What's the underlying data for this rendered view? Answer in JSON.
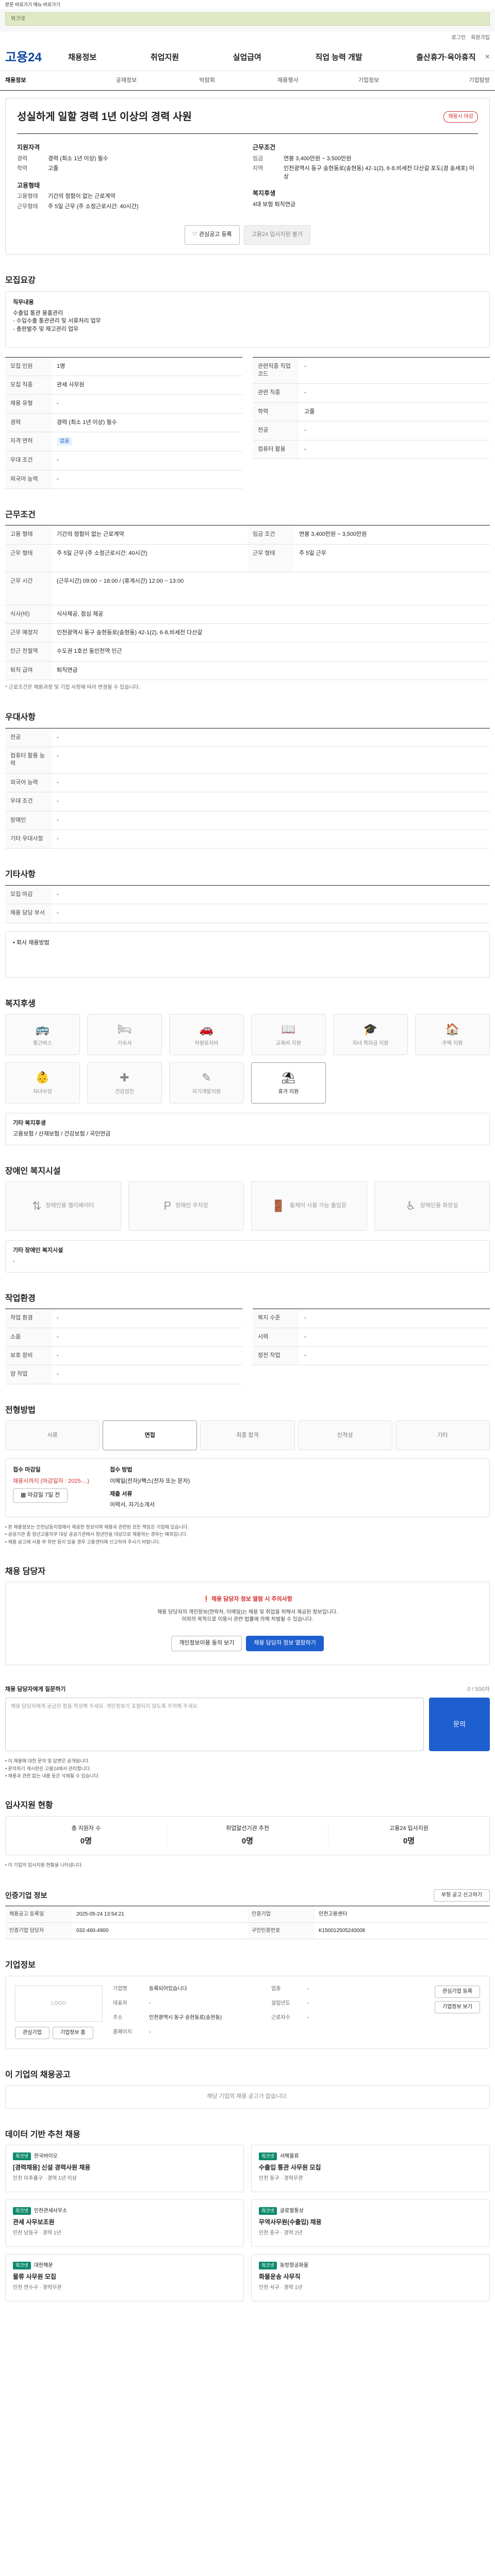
{
  "skip": {
    "text": "본문 바로가기 메뉴 바로가기"
  },
  "ad": {
    "text": "워크넷"
  },
  "util": {
    "login": "로그인",
    "join": "회원가입"
  },
  "header": {
    "logo": "고용24",
    "menu": [
      "채용정보",
      "취업지원",
      "실업급여",
      "직업 능력 개발",
      "출산휴가·육아휴직"
    ],
    "close": "×"
  },
  "tabs": [
    "채용정보",
    "공채정보",
    "박람회",
    "채용행사",
    "기업정보",
    "기업탐방"
  ],
  "job": {
    "title": "성실하게 일할 경력 1년 이상의 경력 사원",
    "badge": "채용시 마감",
    "left": {
      "sec1": "지원자격",
      "exp_k": "경력",
      "exp_v": "경력 (최소 1년 이상) 필수",
      "edu_k": "학력",
      "edu_v": "고졸",
      "sec2": "고용형태",
      "type_k": "고용형태",
      "type_v": "기간의 정함이 없는 근로계약",
      "time_k": "근무형태",
      "time_v": "주 5일 근무 (주 소정근로시간: 40시간)"
    },
    "right": {
      "sec1": "근무조건",
      "pay_k": "임금",
      "pay_v": "연봉 3,400만원 ~ 3,500만원",
      "loc_k": "지역",
      "loc_v": "인천광역시 동구 송현동로(송현동) 42-1(2), 6·8,비세전 다산갈 포도(경 송세포) 이상",
      "sec2": "복지후생",
      "welfare": "4대 보험 퇴직연금"
    },
    "btn_interest": "관심공고 등록",
    "btn_apply": "고용24 입사지원 불가"
  },
  "s_content": {
    "title": "모집요강",
    "body_title": "직무내용",
    "body": "수출입 통관 용품관리\n- 수입수출 통관관리 및 서류처리 업무\n- 총판발주 및 재고관리 업무"
  },
  "s_table1": [
    {
      "k": "모집 인원",
      "v": "1명"
    },
    {
      "k": "모집 직종",
      "v": "관세 사무원"
    },
    {
      "k": "채용 유형",
      "v": "-"
    },
    {
      "k": "경력",
      "v": "경력 (최소 1년 이상) 필수"
    },
    {
      "k": "자격 면허",
      "v": "없음"
    },
    {
      "k": "우대 조건",
      "v": "-"
    },
    {
      "k": "외국어 능력",
      "v": "-"
    }
  ],
  "s_table1b": [
    {
      "k": "관련직종 직업 코드",
      "v": "-"
    },
    {
      "k": "관련 직종",
      "v": "-"
    },
    {
      "k": "학력",
      "v": "고졸"
    },
    {
      "k": "전공",
      "v": "-"
    },
    {
      "k": "컴퓨터 활용",
      "v": "-"
    }
  ],
  "s_cond": {
    "title": "근무조건",
    "rows": [
      {
        "k": "고용 형태",
        "v": "기간의 정함이 없는 근로계약"
      },
      {
        "k": "근무 형태",
        "v": "주 5일 근무 (주 소정근로시간: 40시간)"
      },
      {
        "k": "근무 시간",
        "v": "(근무시간) 09:00 ~ 18:00 / (휴게시간) 12:00 ~ 13:00"
      },
      {
        "k": "식사(비)",
        "v": "식사제공, 점심 제공"
      },
      {
        "k": "근무 예정지",
        "v": "인천광역시 동구 송현동로(송현동) 42-1(2), 6·8,비세전 다산갈"
      },
      {
        "k": "인근 전철역",
        "v": "수도권 1호선 동인천역 인근"
      },
      {
        "k": "퇴직 급여",
        "v": "퇴직연금"
      }
    ],
    "pay": "연봉 3,400만원 ~ 3,500만원",
    "shift": "주 5일 근무",
    "note": "* 근로조건은 채용과정 및 기업 사정에 따라 변경될 수 있습니다."
  },
  "s_pref": {
    "title": "우대사항",
    "rows": [
      {
        "k": "전공",
        "v": "-"
      },
      {
        "k": "컴퓨터 활용 능력",
        "v": "-"
      },
      {
        "k": "외국어 능력",
        "v": "-"
      },
      {
        "k": "우대 조건",
        "v": "-"
      },
      {
        "k": "장애인",
        "v": "-"
      },
      {
        "k": "기타 우대사항",
        "v": "-"
      }
    ]
  },
  "s_etc": {
    "title": "기타사항",
    "rows": [
      {
        "k": "모집 마감",
        "v": "-"
      },
      {
        "k": "채용 담당 부서",
        "v": "-"
      }
    ],
    "box": "• 회사 채용방법"
  },
  "s_welfare": {
    "title": "복지후생",
    "items": [
      "통근버스",
      "기숙사",
      "차량유지비",
      "교육비 지원",
      "자녀 학자금 지원",
      "주택 지원",
      "자녀수당",
      "건강검진",
      "자기개발지원",
      "휴가 지원"
    ],
    "on_index": 9,
    "sub_title": "기타 복지후생",
    "sub_body": "고용보험 / 산재보험 / 건강보험 / 국민연금"
  },
  "s_disabled": {
    "title": "장애인 복지시설",
    "items": [
      "장애인용 엘리베이터",
      "장애인 주차장",
      "휠체어 사용 가능 출입문",
      "장애인용 화장실"
    ],
    "sub_title": "기타 장애인 복지시설",
    "sub_body": "-"
  },
  "s_env": {
    "title": "작업환경",
    "rows": [
      {
        "k": "작업 환경",
        "v": "-"
      },
      {
        "k": "소음",
        "v": "-"
      },
      {
        "k": "보호 장비",
        "v": "-"
      },
      {
        "k": "양 작업",
        "v": "-"
      }
    ],
    "rows_b": [
      {
        "k": "복지 수준",
        "v": "-"
      },
      {
        "k": "시력",
        "v": "-"
      },
      {
        "k": "정전 작업",
        "v": "-"
      }
    ]
  },
  "s_process": {
    "title": "전형방법",
    "steps": [
      "서류",
      "면접",
      "최종 합격",
      "인적성",
      "기타"
    ],
    "on_index": 1,
    "deadline_k": "접수 마감일",
    "deadline_v": "채용시까지 (마감일자 : 2025-...)",
    "method_k": "접수 방법",
    "method_v": "이메일(전자)/팩스(전자 또는 문자)",
    "doc_k": "제출 서류",
    "doc_v": "이력서, 자기소개서",
    "btn": "마감일 7일 전",
    "notes": "• 본 채용정보는 인천남동지청에서 제공한 정보이며 채용과 관련된 모든 책임은 기업에 있습니다.\n• 공공기관 중 청년고용의무 대상 공공기관에서 청년만을 대상으로 채용하는 경우는 예외입니다.\n• 채용 공고에 사용 부 위반 등이 있을 경우 고용센터에 신고하여 주시기 바랍니다."
  },
  "s_contact": {
    "title": "채용 담당자",
    "warn": "채용 담당자 정보 열람 시 주의사항",
    "desc": "채용 담당자의 개인정보(연락처, 이메일)는 채용 및 취업을 위해서 제공된 정보입니다.\n이외의 목적으로 이용시 관련 법률에 의해 처벌될 수 있습니다.",
    "btn1": "개인정보이용 동의 보기",
    "btn2": "채용 담당자 정보 열람하기"
  },
  "s_question": {
    "title": "채용 담당자에게 질문하기",
    "limit": "0 / 500자",
    "placeholder": "채용 담당자에게 궁금한 점을 작성해 주세요. 개인정보가 포함되지 않도록 주의해 주세요.",
    "submit": "문의",
    "notes": "• 이 채용에 대한 문의 및 답변은 공개됩니다.\n• 문의하기 게시판은 고용24에서 관리합니다.\n• 채용과 관련 없는 내용 등은 삭제될 수 있습니다."
  },
  "s_status": {
    "title": "입사지원 현황",
    "items": [
      {
        "label": "총 지원자 수",
        "value": "0명"
      },
      {
        "label": "취업알선기관 추천",
        "value": "0명"
      },
      {
        "label": "고용24 입사지원",
        "value": "0명"
      }
    ],
    "note": "• 이 기업의 입사지원 현황을 나타냅니다."
  },
  "s_info": {
    "title": "인증기업 정보",
    "rows": [
      {
        "h": "채용공고 등록일",
        "d": "2025-05-24 13:54:21",
        "h2": "인증기업",
        "d2": "인천고용센터"
      },
      {
        "h": "인증기업 담당자",
        "d": "032-460-4900",
        "h2": "구인인증번호",
        "d2": "K150012505240008"
      }
    ],
    "btn": "부정 공고 신고하기"
  },
  "s_company": {
    "title": "기업정보",
    "logo": "LOGO",
    "rows": [
      {
        "h": "기업명",
        "d": "등록되어있습니다",
        "h2": "업종",
        "d2": "-"
      },
      {
        "h": "대표자",
        "d": "-",
        "h2": "설립년도",
        "d2": "-"
      },
      {
        "h": "주소",
        "d": "인천광역시 동구 송현동로(송현동)",
        "h2": "근로자수",
        "d2": "-"
      },
      {
        "h": "홈페이지",
        "d": "-",
        "h2": "",
        "d2": ""
      }
    ],
    "btn1": "관심기업 등록",
    "btn2": "기업정보 보기",
    "btn_a": "관심기업",
    "btn_b": "기업정보 홈"
  },
  "s_similar": {
    "title": "이 기업의 채용공고",
    "empty": "해당 기업의 채용 공고가 없습니다."
  },
  "s_recommend": {
    "title": "데이터 기반 추천 채용",
    "items": [
      {
        "tag": "워크넷",
        "company": "한국바이오",
        "title": "[경력채용] 신설 경력사원 채용",
        "meta": "인천 미추홀구 · 경력 1년 이상"
      },
      {
        "tag": "워크넷",
        "company": "서해물류",
        "title": "수출입 통관 사무원 모집",
        "meta": "인천 동구 · 경력무관"
      },
      {
        "tag": "워크넷",
        "company": "인천관세사무소",
        "title": "관세 사무보조원",
        "meta": "인천 남동구 · 경력 1년"
      },
      {
        "tag": "워크넷",
        "company": "글로벌통상",
        "title": "무역사무원(수출입) 채용",
        "meta": "인천 중구 · 경력 2년"
      },
      {
        "tag": "워크넷",
        "company": "대한해운",
        "title": "물류 사무원 모집",
        "meta": "인천 연수구 · 경력무관"
      },
      {
        "tag": "워크넷",
        "company": "동방항공화물",
        "title": "화물운송 사무직",
        "meta": "인천 서구 · 경력 1년"
      }
    ]
  }
}
